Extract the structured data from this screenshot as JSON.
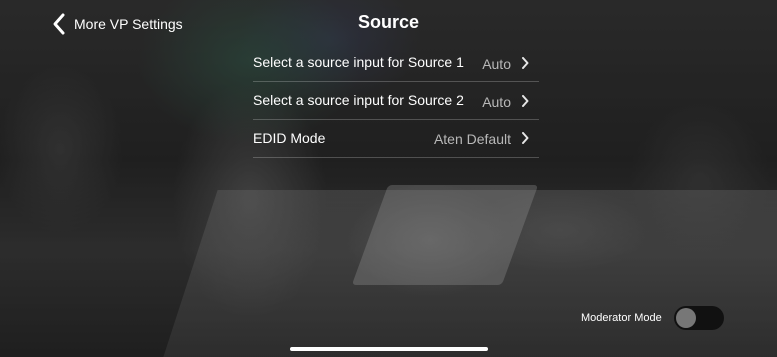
{
  "nav": {
    "back_label": "More VP Settings",
    "title": "Source"
  },
  "settings": [
    {
      "label": "Select a source input for Source 1",
      "value": "Auto"
    },
    {
      "label": "Select a source input for Source 2",
      "value": "Auto"
    },
    {
      "label": "EDID Mode",
      "value": "Aten Default"
    }
  ],
  "moderator": {
    "label": "Moderator Mode",
    "enabled": false
  },
  "icons": {
    "back": "chevron-left-icon",
    "disclosure": "chevron-right-icon"
  }
}
